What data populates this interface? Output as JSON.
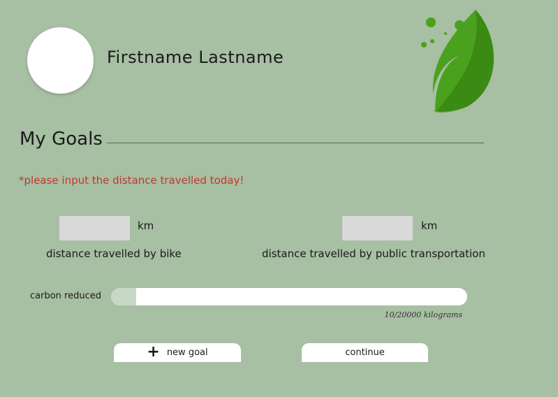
{
  "profile": {
    "name": "Firstname Lastname"
  },
  "logo": {
    "icon": "leaf-icon",
    "colors": [
      "#4aa11e",
      "#3a8a14"
    ]
  },
  "goals": {
    "title": "My Goals",
    "warning": "*please input the distance travelled today!",
    "bike": {
      "value": "",
      "unit": "km",
      "label": "distance travelled by bike"
    },
    "transit": {
      "value": "",
      "unit": "km",
      "label": "distance travelled by public transportation"
    },
    "progress": {
      "label": "carbon reduced",
      "current": 10,
      "goal": 20000,
      "caption": "10/20000 kilograms"
    },
    "buttons": {
      "new_goal": "new goal",
      "continue": "continue"
    }
  },
  "colors": {
    "background": "#a7bfa3",
    "warning": "#c0392b",
    "leaf": "#4aa11e"
  }
}
